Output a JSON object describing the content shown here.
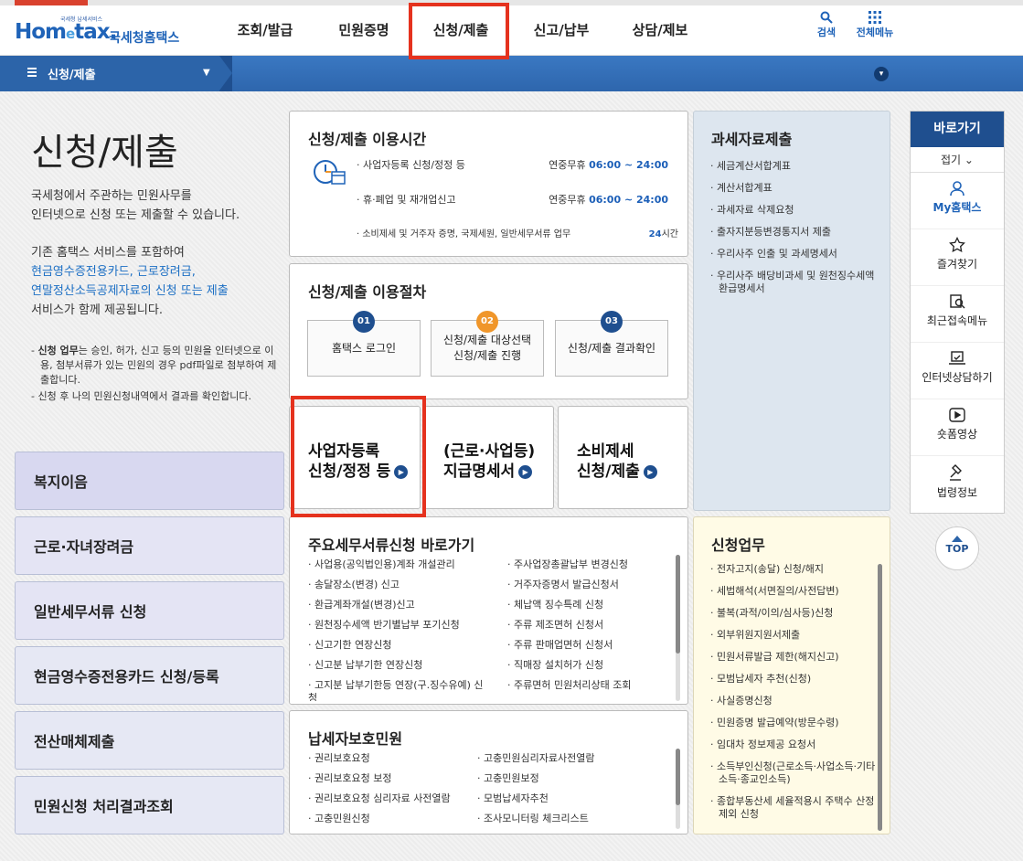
{
  "header": {
    "logo_small": "국세청 납세서비스",
    "logo_main": "Hom",
    "logo_e": "e",
    "logo_tail": "tax.",
    "logo_kr": "국세청홈택스",
    "gnb": [
      "조회/발급",
      "민원증명",
      "신청/제출",
      "신고/납부",
      "상담/제보"
    ],
    "search_label": "검색",
    "allmenu_label": "전체메뉴"
  },
  "navbar": {
    "title": "신청/제출"
  },
  "page": {
    "title": "신청/제출",
    "desc1": "국세청에서 주관하는 민원사무를",
    "desc2": "인터넷으로 신청 또는 제출할 수 있습니다.",
    "desc3": "기존 홈택스 서비스를 포함하여",
    "desc4": "현금영수증전용카드, 근로장려금,",
    "desc5": "연말정산소득공제자료의 신청 또는 제출",
    "desc6": "서비스가 함께 제공됩니다.",
    "note1_bold": "신청 업무",
    "note1": "는 승인, 허가, 신고 등의 민원을 인터넷으로 이용, 첨부서류가 있는 민원의 경우 pdf파일로 첨부하여 제출합니다.",
    "note2": "신청 후 나의 민원신청내역에서 결과를 확인합니다."
  },
  "left_menu": [
    "복지이음",
    "근로·자녀장려금",
    "일반세무서류 신청",
    "현금영수증전용카드 신청/등록",
    "전산매체제출",
    "민원신청 처리결과조회"
  ],
  "hours": {
    "title": "신청/제출 이용시간",
    "rows": [
      {
        "label": "· 사업자등록 신청/정정 등",
        "pre": "연중무휴 ",
        "time": "06:00 ~ 24:00"
      },
      {
        "label": "· 휴·폐업 및 재개업신고",
        "pre": "연중무휴 ",
        "time": "06:00 ~ 24:00"
      },
      {
        "label": "· 소비제세 및 거주자 증명, 국제세원, 일반세무서류 업무",
        "pre": "",
        "time": "24",
        "suffix": "시간"
      }
    ]
  },
  "procedure": {
    "title": "신청/제출 이용절차",
    "steps": [
      {
        "num": "01",
        "line1": "홈택스 로그인",
        "line2": "",
        "color": "#1f4f8f"
      },
      {
        "num": "02",
        "line1": "신청/제출 대상선택",
        "line2": "신청/제출 진행",
        "color": "#f0962a"
      },
      {
        "num": "03",
        "line1": "신청/제출 결과확인",
        "line2": "",
        "color": "#1f4f8f"
      }
    ]
  },
  "big_buttons": [
    {
      "line1": "사업자등록",
      "line2": "신청/정정 등"
    },
    {
      "line1": "(근로·사업등)",
      "line2": "지급명세서"
    },
    {
      "line1": "소비제세",
      "line2": "신청/제출"
    }
  ],
  "tax_data": {
    "title": "과세자료제출",
    "items": [
      "세금계산서합계표",
      "계산서합계표",
      "과세자료 삭제요청",
      "출자지분등변경통지서 제출",
      "우리사주 인출 및 과세명세서",
      "우리사주 배당비과세 및 원천징수세액 환급명세서"
    ]
  },
  "main_docs": {
    "title": "주요세무서류신청 바로가기",
    "col1": [
      "사업용(공익법인용)계좌 개설관리",
      "송달장소(변경) 신고",
      "환급계좌개설(변경)신고",
      "원천징수세액 반기별납부 포기신청",
      "신고기한 연장신청",
      "신고분 납부기한 연장신청",
      "고지분 납부기한등 연장(구.징수유예) 신청"
    ],
    "col2": [
      "주사업장총괄납부 변경신청",
      "거주자증명서 발급신청서",
      "체납액 징수특례 신청",
      "주류 제조면허 신청서",
      "주류 판매업면허 신청서",
      "직매장 설치허가 신청",
      "주류면허 민원처리상태 조회"
    ]
  },
  "protection": {
    "title": "납세자보호민원",
    "col1": [
      "권리보호요청",
      "권리보호요청 보정",
      "권리보호요청 심리자료 사전열람",
      "고충민원신청"
    ],
    "col2": [
      "고충민원심리자료사전열람",
      "고충민원보정",
      "모범납세자추천",
      "조사모니터링 체크리스트"
    ]
  },
  "apply": {
    "title": "신청업무",
    "items": [
      "전자고지(송달) 신청/해지",
      "세법해석(서면질의/사전답변)",
      "불복(과적/이의/심사등)신청",
      "외부위원지원서제출",
      "민원서류발급 제한(해지신고)",
      "모범납세자 추천(신청)",
      "사실증명신청",
      "민원증명 발급예약(방문수령)",
      "임대차 정보제공 요청서",
      "소득부인신청(근로소득·사업소득·기타소득·종교인소득)",
      "종합부동산세 세율적용시 주택수 산정제외 신청"
    ]
  },
  "side": {
    "title": "바로가기",
    "fold": "접기",
    "items": [
      "My홈택스",
      "즐겨찾기",
      "최근접속메뉴",
      "인터넷상담하기",
      "숏폼영상",
      "법령정보"
    ],
    "top": "TOP"
  },
  "colors": {
    "brand": "#1f63b8",
    "nav": "#1f4f8f",
    "highlight": "#e5321e"
  }
}
